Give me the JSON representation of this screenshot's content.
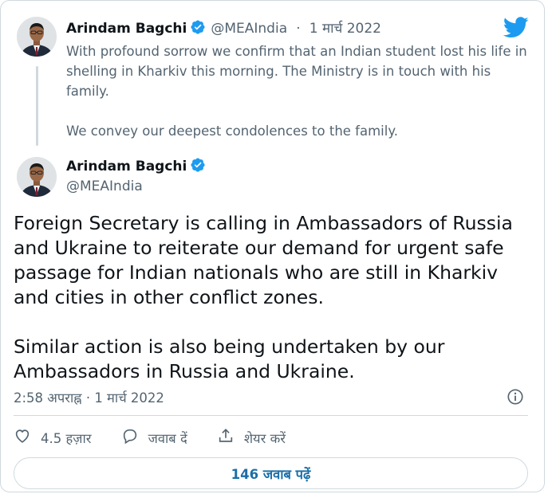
{
  "colors": {
    "brand_blue": "#1d9bf0",
    "text_primary": "#0f1419",
    "text_secondary": "#536471",
    "border": "#cfd9de",
    "link": "#1b6ea8"
  },
  "reply_tweet": {
    "author_name": "Arindam Bagchi",
    "handle": "@MEAIndia",
    "separator": "·",
    "date": "1 मार्च 2022",
    "paragraphs": [
      "With profound sorrow we confirm that an Indian student lost his life in shelling in Kharkiv this morning. The Ministry is in touch with his family.",
      "We convey our deepest condolences to the family."
    ]
  },
  "main_tweet": {
    "author_name": "Arindam Bagchi",
    "handle": "@MEAIndia",
    "text": "Foreign Secretary is calling in Ambassadors of Russia and Ukraine to reiterate our demand for urgent safe passage for Indian nationals who are still in Kharkiv and cities in other conflict zones.\n\nSimilar action is also being undertaken by our Ambassadors in Russia and Ukraine.",
    "time": "2:58 अपराह्न",
    "separator": "·",
    "date": "1 मार्च 2022"
  },
  "actions": {
    "like_count": "4.5 हज़ार",
    "reply_label": "जवाब दें",
    "share_label": "शेयर करें"
  },
  "read_replies_label": "146 जवाब पढ़ें",
  "icons": {
    "logo": "twitter-bird-icon",
    "verified": "verified-badge-icon",
    "info": "info-icon",
    "like": "heart-icon",
    "reply": "speech-bubble-icon",
    "share": "share-icon"
  }
}
